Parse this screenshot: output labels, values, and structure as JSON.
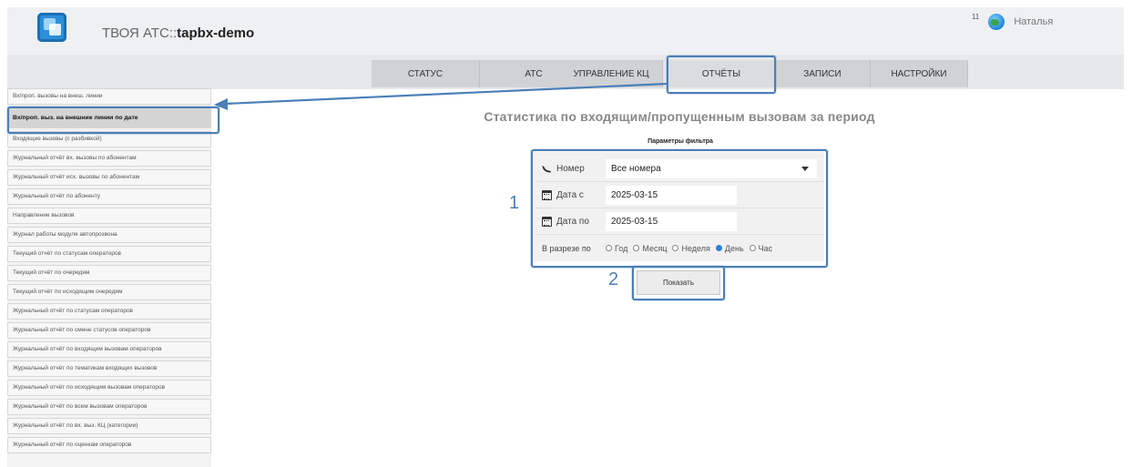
{
  "header": {
    "app_prefix": "ТВОЯ АТС::",
    "app_name": "tapbx-demo",
    "notif_count": "11",
    "user_name": "Наталья",
    "accent_color": "#4a7fb8"
  },
  "nav": {
    "tabs": [
      {
        "label": "СТАТУС"
      },
      {
        "label": "АТС"
      },
      {
        "label": "УПРАВЛЕНИЕ КЦ"
      },
      {
        "label": "ОТЧЁТЫ"
      },
      {
        "label": "ЗАПИСИ"
      },
      {
        "label": "НАСТРОЙКИ"
      }
    ],
    "active": "ОТЧЁТЫ"
  },
  "sidebar": {
    "items": [
      {
        "label": "Вх/проп. вызовы на внеш. линии"
      },
      {
        "label": "Вх/проп. выз. на внешние линии по дате"
      },
      {
        "label": "Входящие вызовы (с разбивкой)"
      },
      {
        "label": "Журнальный отчёт вх. вызовы по абонентам"
      },
      {
        "label": "Журнальный отчёт исх. вызовы по абонентам"
      },
      {
        "label": "Журнальный отчёт по абоненту"
      },
      {
        "label": "Направление вызовов"
      },
      {
        "label": "Журнал работы модуля автопрозвона"
      },
      {
        "label": "Текущий отчёт по статусам операторов"
      },
      {
        "label": "Текущий отчёт по очередям"
      },
      {
        "label": "Текущий отчёт по исходящим очередям"
      },
      {
        "label": "Журнальный отчёт по статусам операторов"
      },
      {
        "label": "Журнальный отчёт по смене статусов операторов"
      },
      {
        "label": "Журнальный отчёт по входящим вызовам операторов"
      },
      {
        "label": "Журнальный отчёт по тематикам входящих вызовов"
      },
      {
        "label": "Журнальный отчёт по исходящим вызовам операторов"
      },
      {
        "label": "Журнальный отчёт по всем вызовам операторов"
      },
      {
        "label": "Журнальный отчёт по вх. выз. КЦ (категории)"
      },
      {
        "label": "Журнальный отчёт по оценкам операторов"
      }
    ],
    "active_index": 1
  },
  "main": {
    "title": "Статистика по входящим/пропущенным вызовам за период",
    "filter_caption": "Параметры фильтра",
    "number_label": "Номер",
    "number_value": "Все номера",
    "date_from_label": "Дата с",
    "date_from_value": "2025-03-15",
    "date_to_label": "Дата по",
    "date_to_value": "2025-03-15",
    "breakdown_label": "В разрезе по",
    "breakdown_options": [
      {
        "label": "Год",
        "checked": false
      },
      {
        "label": "Месяц",
        "checked": false
      },
      {
        "label": "Неделя",
        "checked": false
      },
      {
        "label": "День",
        "checked": true
      },
      {
        "label": "Час",
        "checked": false
      }
    ],
    "show_button": "Показать"
  },
  "annotations": {
    "step1": "1",
    "step2": "2"
  }
}
